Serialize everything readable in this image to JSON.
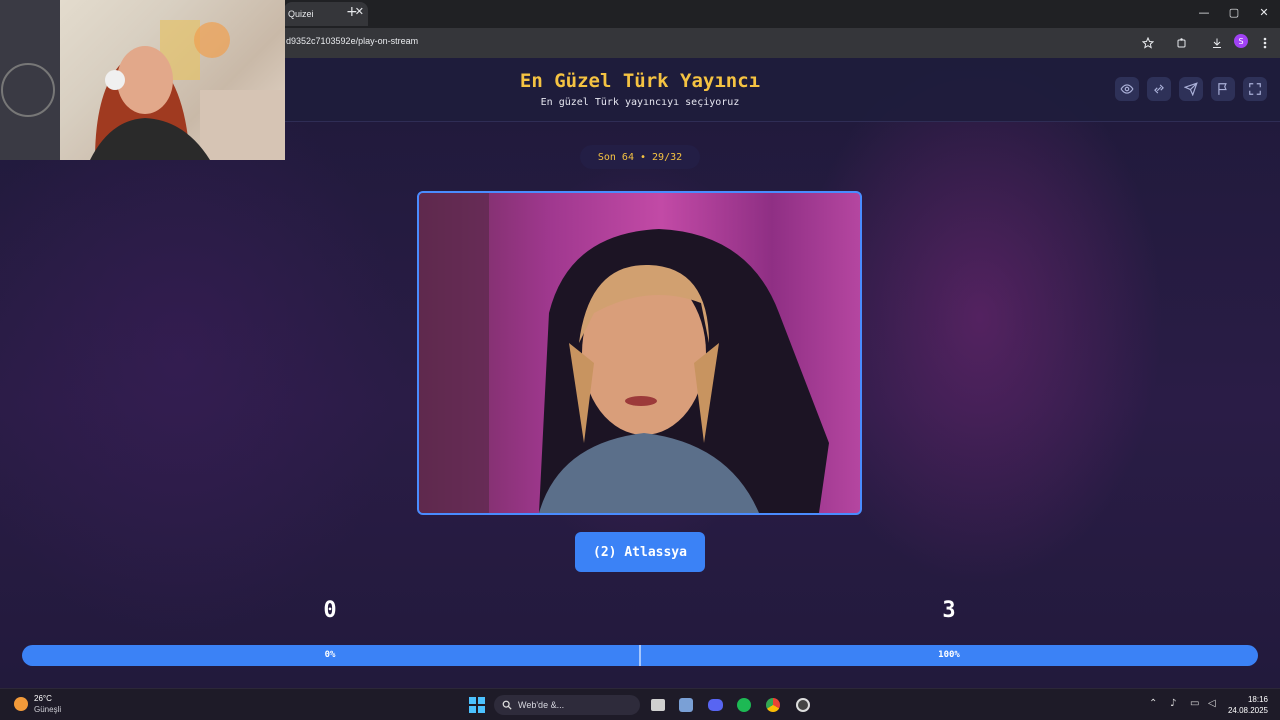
{
  "browser": {
    "tab_title": "Quizei",
    "tab_close": "✕",
    "new_tab": "+",
    "url": "d9352c7103592e/play-on-stream",
    "win_min": "—",
    "win_max": "▢",
    "win_close": "✕",
    "profile_initial": "S"
  },
  "page": {
    "title": "En Güzel Türk Yayıncı",
    "subtitle": "En güzel Türk yayıncıyı seçiyoruz",
    "header_icons": [
      "eye-icon",
      "share-icon",
      "send-icon",
      "flag-icon",
      "fullscreen-icon"
    ],
    "round_label": "Son 64 • 29/32",
    "contestant_label": "(2) Atlassya",
    "score_left": "0",
    "score_right": "3",
    "progress_left_label": "0%",
    "progress_right_label": "100%",
    "progress_value": 0
  },
  "taskbar": {
    "weather_temp": "26°C",
    "weather_desc": "Güneşli",
    "search_placeholder": "Web'de &...",
    "time": "18:16",
    "date": "24.08.2025"
  },
  "colors": {
    "accent_blue": "#3b82f6",
    "title_gold": "#f5c342",
    "header_bg": "#1e1c3c"
  }
}
